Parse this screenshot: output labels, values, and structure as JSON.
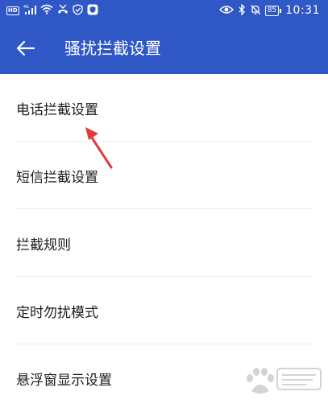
{
  "status_bar": {
    "left_icons": [
      "hd-icon",
      "signal-4g-icon",
      "wifi-icon",
      "missed-call-icon",
      "shield-icon",
      "security-app-icon"
    ],
    "hd_label": "HD",
    "network_label": "4G",
    "right_icons": [
      "eye-icon",
      "bluetooth-icon",
      "silent-bell-icon",
      "battery-icon"
    ],
    "battery_level": "85",
    "time": "10:31"
  },
  "header": {
    "title": "骚扰拦截设置",
    "back_icon": "arrow-left-icon"
  },
  "menu": {
    "items": [
      {
        "label": "电话拦截设置"
      },
      {
        "label": "短信拦截设置"
      },
      {
        "label": "拦截规则"
      },
      {
        "label": "定时勿扰模式"
      },
      {
        "label": "悬浮窗显示设置"
      }
    ]
  },
  "colors": {
    "header_bg": "#2f57c6",
    "annotation_arrow": "#e53935",
    "divider": "#ececec"
  },
  "watermark": {
    "icon": "baidu-jingyan-watermark-icon"
  }
}
